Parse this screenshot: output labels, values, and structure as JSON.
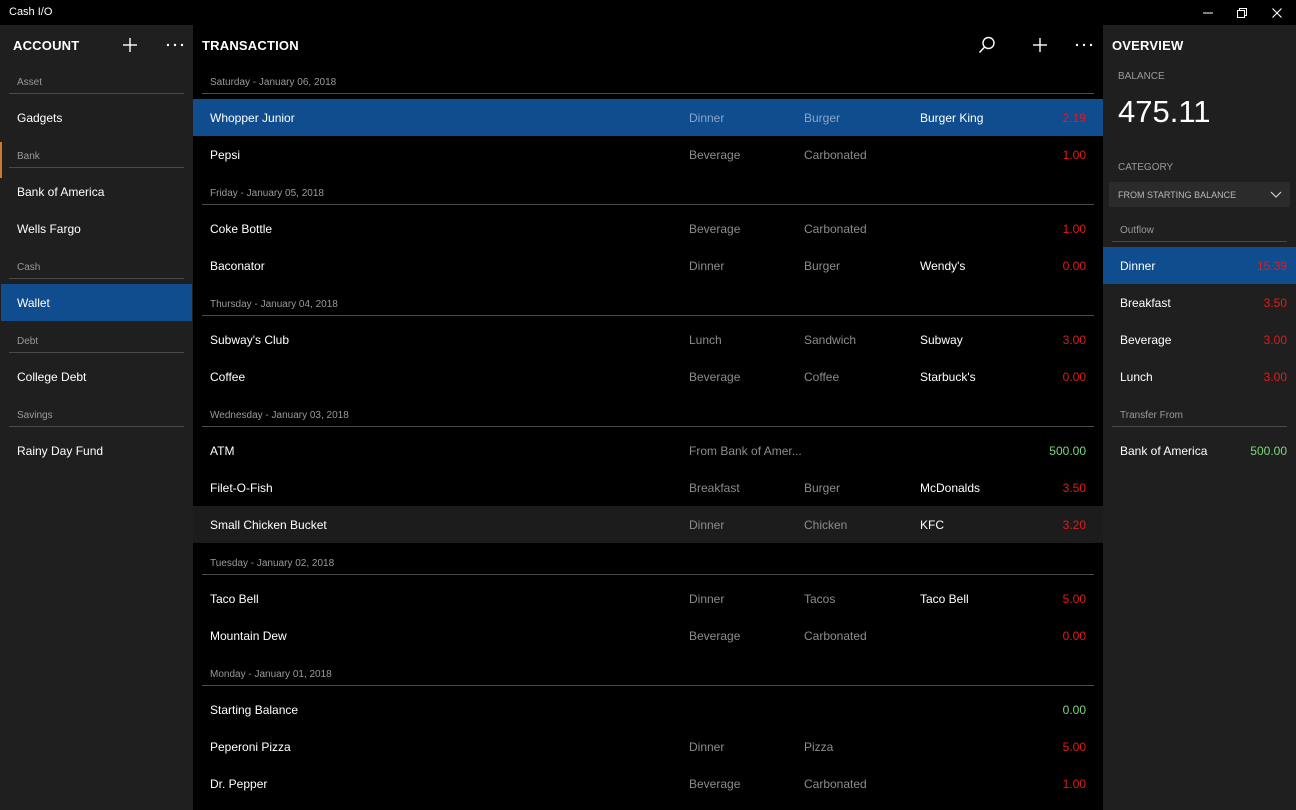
{
  "window": {
    "title": "Cash I/O"
  },
  "accounts": {
    "title": "ACCOUNT",
    "groups": [
      {
        "label": "Asset",
        "items": [
          {
            "label": "Gadgets"
          }
        ]
      },
      {
        "label": "Bank",
        "items": [
          {
            "label": "Bank of America"
          },
          {
            "label": "Wells Fargo"
          }
        ]
      },
      {
        "label": "Cash",
        "items": [
          {
            "label": "Wallet",
            "selected": true
          }
        ]
      },
      {
        "label": "Debt",
        "items": [
          {
            "label": "College Debt"
          }
        ]
      },
      {
        "label": "Savings",
        "items": [
          {
            "label": "Rainy Day Fund"
          }
        ]
      }
    ]
  },
  "transactions": {
    "title": "TRANSACTION",
    "days": [
      {
        "date": "Saturday - January 06, 2018",
        "rows": [
          {
            "name": "Whopper Junior",
            "category": "Dinner",
            "subcategory": "Burger",
            "payee": "Burger King",
            "amount": "2.19",
            "sign": "neg",
            "state": "selected"
          },
          {
            "name": "Pepsi",
            "category": "Beverage",
            "subcategory": "Carbonated",
            "payee": "",
            "amount": "1.00",
            "sign": "neg"
          }
        ]
      },
      {
        "date": "Friday - January 05, 2018",
        "rows": [
          {
            "name": "Coke Bottle",
            "category": "Beverage",
            "subcategory": "Carbonated",
            "payee": "",
            "amount": "1.00",
            "sign": "neg"
          },
          {
            "name": "Baconator",
            "category": "Dinner",
            "subcategory": "Burger",
            "payee": "Wendy's",
            "amount": "0.00",
            "sign": "neg"
          }
        ]
      },
      {
        "date": "Thursday - January 04, 2018",
        "rows": [
          {
            "name": "Subway's Club",
            "category": "Lunch",
            "subcategory": "Sandwich",
            "payee": "Subway",
            "amount": "3.00",
            "sign": "neg"
          },
          {
            "name": "Coffee",
            "category": "Beverage",
            "subcategory": "Coffee",
            "payee": "Starbuck's",
            "amount": "0.00",
            "sign": "neg"
          }
        ]
      },
      {
        "date": "Wednesday - January 03, 2018",
        "rows": [
          {
            "name": "ATM",
            "category": "From Bank of Amer...",
            "subcategory": "",
            "payee": "",
            "amount": "500.00",
            "sign": "pos"
          },
          {
            "name": "Filet-O-Fish",
            "category": "Breakfast",
            "subcategory": "Burger",
            "payee": "McDonalds",
            "amount": "3.50",
            "sign": "neg"
          },
          {
            "name": "Small Chicken Bucket",
            "category": "Dinner",
            "subcategory": "Chicken",
            "payee": "KFC",
            "amount": "3.20",
            "sign": "neg",
            "state": "hover"
          }
        ]
      },
      {
        "date": "Tuesday - January 02, 2018",
        "rows": [
          {
            "name": "Taco Bell",
            "category": "Dinner",
            "subcategory": "Tacos",
            "payee": "Taco Bell",
            "amount": "5.00",
            "sign": "neg"
          },
          {
            "name": "Mountain Dew",
            "category": "Beverage",
            "subcategory": "Carbonated",
            "payee": "",
            "amount": "0.00",
            "sign": "neg"
          }
        ]
      },
      {
        "date": "Monday - January 01, 2018",
        "rows": [
          {
            "name": "Starting Balance",
            "category": "",
            "subcategory": "",
            "payee": "",
            "amount": "0.00",
            "sign": "pos"
          },
          {
            "name": "Peperoni Pizza",
            "category": "Dinner",
            "subcategory": "Pizza",
            "payee": "",
            "amount": "5.00",
            "sign": "neg"
          },
          {
            "name": "Dr. Pepper",
            "category": "Beverage",
            "subcategory": "Carbonated",
            "payee": "",
            "amount": "1.00",
            "sign": "neg"
          }
        ]
      }
    ]
  },
  "overview": {
    "title": "OVERVIEW",
    "balance_label": "BALANCE",
    "balance": "475.11",
    "category_label": "CATEGORY",
    "dropdown_value": "FROM STARTING BALANCE",
    "outflow_label": "Outflow",
    "outflow": [
      {
        "label": "Dinner",
        "amount": "15.39",
        "selected": true
      },
      {
        "label": "Breakfast",
        "amount": "3.50"
      },
      {
        "label": "Beverage",
        "amount": "3.00"
      },
      {
        "label": "Lunch",
        "amount": "3.00"
      }
    ],
    "transfer_label": "Transfer From",
    "transfer": [
      {
        "label": "Bank of America",
        "amount": "500.00"
      }
    ]
  },
  "colors": {
    "accent": "#0f4d8e",
    "negative": "#e11b1b",
    "positive": "#7dd77d",
    "bank_marker": "#c77a2e"
  }
}
